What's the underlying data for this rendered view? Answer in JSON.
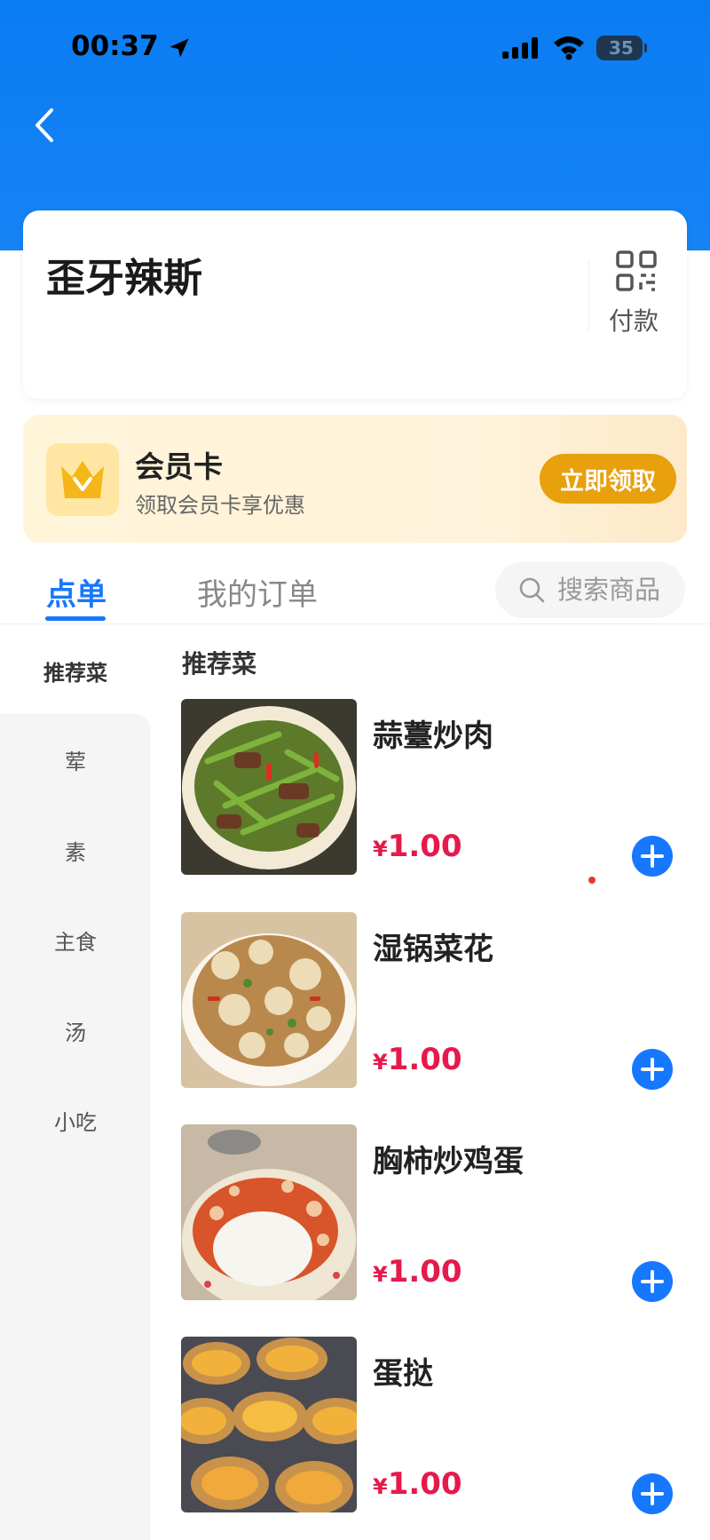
{
  "status_bar": {
    "time": "00:37",
    "battery": "35"
  },
  "shop": {
    "name": "歪牙辣斯",
    "pay_label": "付款"
  },
  "member": {
    "title": "会员卡",
    "subtitle": "领取会员卡享优惠",
    "button_label": "立即领取"
  },
  "tabs": [
    {
      "label": "点单",
      "active": true
    },
    {
      "label": "我的订单",
      "active": false
    }
  ],
  "search": {
    "placeholder": "搜索商品"
  },
  "categories": [
    {
      "label": "推荐菜",
      "active": true
    },
    {
      "label": "荤",
      "active": false
    },
    {
      "label": "素",
      "active": false
    },
    {
      "label": "主食",
      "active": false
    },
    {
      "label": "汤",
      "active": false
    },
    {
      "label": "小吃",
      "active": false
    }
  ],
  "section_title": "推荐菜",
  "products": [
    {
      "name": "蒜薹炒肉",
      "currency": "¥",
      "price": "1.00"
    },
    {
      "name": "湿锅菜花",
      "currency": "¥",
      "price": "1.00"
    },
    {
      "name": "胸柿炒鸡蛋",
      "currency": "¥",
      "price": "1.00"
    },
    {
      "name": "蛋挞",
      "currency": "¥",
      "price": "1.00"
    }
  ],
  "colors": {
    "brand_blue": "#1677ff",
    "price_red": "#e6194b",
    "member_button": "#e8a00c"
  }
}
